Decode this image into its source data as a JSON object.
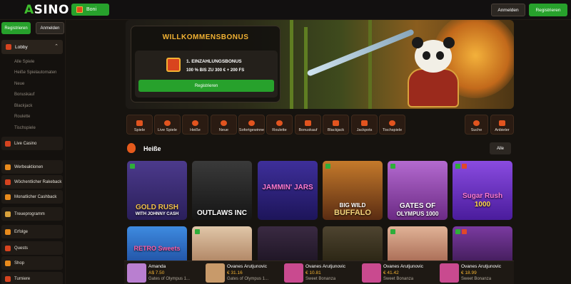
{
  "header": {
    "logo_prefix": "A",
    "logo_text": "SINO",
    "bonus_label": "Boni",
    "login_label": "Anmelden",
    "register_label": "Registrieren"
  },
  "sidebar": {
    "register_label": "Registrieren",
    "login_label": "Anmelden",
    "lobby_label": "Lobby",
    "lobby_subitems": [
      "Alle Spiele",
      "Heiße Spielautomaten",
      "Neue",
      "Bonuskauf",
      "Blackjack",
      "Roulette",
      "Tischspiele"
    ],
    "items": [
      {
        "label": "Live Casino",
        "icon": "live-casino-icon"
      },
      {
        "label": "Werbeaktionen",
        "icon": "promotions-icon"
      },
      {
        "label": "Wöchentlicher Rakeback",
        "icon": "rakeback-icon"
      },
      {
        "label": "Monatlicher Cashback",
        "icon": "cashback-icon"
      },
      {
        "label": "Treueprogramm",
        "icon": "loyalty-icon"
      },
      {
        "label": "Erfolge",
        "icon": "achievements-icon"
      },
      {
        "label": "Quests",
        "icon": "quests-icon"
      },
      {
        "label": "Shop",
        "icon": "shop-icon"
      },
      {
        "label": "Turniere",
        "icon": "tournaments-icon"
      }
    ]
  },
  "welcome": {
    "title": "WILLKOMMENSBONUS",
    "deposit_label": "1. EINZAHLUNGSBONUS",
    "deposit_offer": "100 % BIS ZU 300 € + 200 FS",
    "register_label": "Registrieren"
  },
  "categories": [
    {
      "label": "Spiele",
      "icon": "grid-icon"
    },
    {
      "label": "Live Spiele",
      "icon": "dealer-icon"
    },
    {
      "label": "Heiße",
      "icon": "fire-icon"
    },
    {
      "label": "Neue",
      "icon": "gem-icon"
    },
    {
      "label": "Sofortgewinne",
      "icon": "lightning-icon"
    },
    {
      "label": "Roulette",
      "icon": "roulette-icon"
    },
    {
      "label": "Bonuskauf",
      "icon": "gift-icon"
    },
    {
      "label": "Blackjack",
      "icon": "cards-icon"
    },
    {
      "label": "Jackpots",
      "icon": "jackpot-icon"
    },
    {
      "label": "Tischspiele",
      "icon": "table-games-icon"
    }
  ],
  "tools": [
    {
      "label": "Suche",
      "icon": "search-icon"
    },
    {
      "label": "Anbieter",
      "icon": "providers-icon"
    }
  ],
  "hot_section": {
    "title": "Heiße",
    "all_label": "Alle",
    "games_row1": [
      {
        "title": "GOLD RUSH",
        "subtitle": "WITH JOHNNY CASH",
        "color": "#3a2c6e"
      },
      {
        "title": "OUTLAWS INC",
        "subtitle": "",
        "color": "#1f1f1f"
      },
      {
        "title": "JAMMIN' JARS",
        "subtitle": "",
        "color": "#2a1f6b"
      },
      {
        "title": "BIG WILD",
        "subtitle": "BUFFALO",
        "color": "#6b3b1a"
      },
      {
        "title": "GATES OF",
        "subtitle": "OLYMPUS 1000",
        "color": "#8a3c9c"
      },
      {
        "title": "Sugar Rush",
        "subtitle": "1000",
        "color": "#6a2bbd"
      }
    ],
    "games_row2": [
      {
        "title": "RETRO Sweets",
        "color": "#2b6fc9"
      },
      {
        "title": "",
        "color": "#c99a78"
      },
      {
        "title": "",
        "color": "#2a1a2e"
      },
      {
        "title": "",
        "color": "#3a3323"
      },
      {
        "title": "",
        "color": "#c98a6a"
      },
      {
        "title": "",
        "color": "#5a2b7a"
      }
    ]
  },
  "ticker": [
    {
      "name": "Amanda",
      "amount": "A$ 7.50",
      "game": "Gates of Olympus 1..."
    },
    {
      "name": "Ovanes Arutjunovic",
      "amount": "€ 31.16",
      "game": "Gates of Olympus 1..."
    },
    {
      "name": "Ovanes Arutjunovic",
      "amount": "€ 10.81",
      "game": "Sweet Bonanza"
    },
    {
      "name": "Ovanes Arutjunovic",
      "amount": "€ 41.42",
      "game": "Sweet Bonanza"
    },
    {
      "name": "Ovanes Arutjunovic",
      "amount": "€ 18.99",
      "game": "Sweet Bonanza"
    }
  ],
  "colors": {
    "accent_green": "#27a12c",
    "gold": "#f2b233",
    "background": "#16130f"
  }
}
